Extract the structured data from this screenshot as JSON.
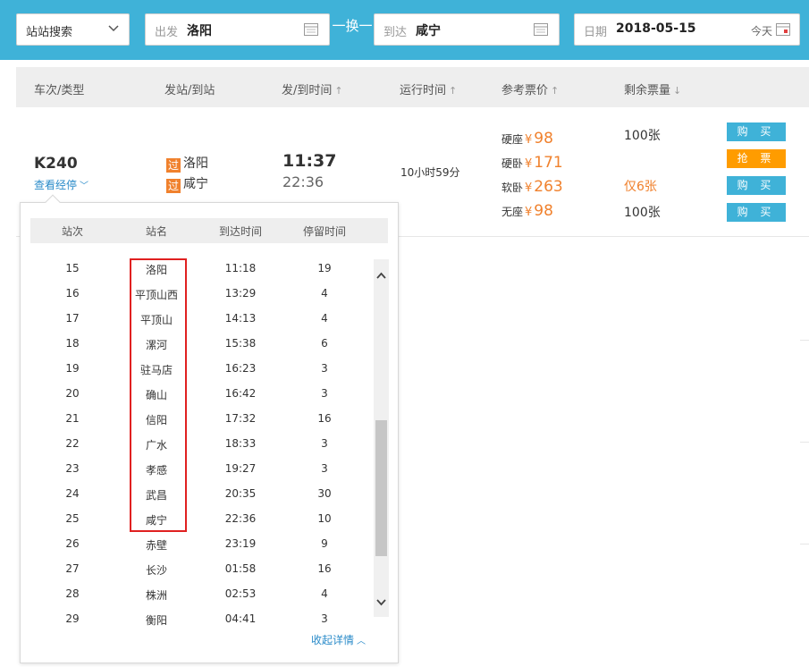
{
  "search": {
    "mode_label": "站站搜索",
    "from_label": "出发",
    "from_value": "洛阳",
    "swap_label": "一换一",
    "to_label": "到达",
    "to_value": "咸宁",
    "date_label": "日期",
    "date_value": "2018-05-15",
    "today_label": "今天"
  },
  "table_header": {
    "train_type": "车次/类型",
    "stations": "发站/到站",
    "times": "发/到时间",
    "duration": "运行时间",
    "price": "参考票价",
    "remaining": "剩余票量",
    "sort_up": "↑",
    "sort_down": "↓"
  },
  "train": {
    "number": "K240",
    "view_stops": "查看经停",
    "pass_tag": "过",
    "from_station": "洛阳",
    "to_station": "咸宁",
    "depart_time": "11:37",
    "arrive_time": "22:36",
    "duration": "10小时59分",
    "currency": "¥",
    "fares": [
      {
        "class": "硬座",
        "price": "98",
        "remaining": "100张",
        "button": "购 买",
        "warn": false,
        "grab": false
      },
      {
        "class": "硬卧",
        "price": "171",
        "remaining": "",
        "button": "抢 票",
        "warn": false,
        "grab": true
      },
      {
        "class": "软卧",
        "price": "263",
        "remaining": "仅6张",
        "button": "购 买",
        "warn": true,
        "grab": false
      },
      {
        "class": "无座",
        "price": "98",
        "remaining": "100张",
        "button": "购 买",
        "warn": false,
        "grab": false
      }
    ]
  },
  "stops_popup": {
    "headers": {
      "no": "站次",
      "name": "站名",
      "arrive": "到达时间",
      "stay": "停留时间"
    },
    "rows": [
      {
        "no": "15",
        "name": "洛阳",
        "arrive": "11:18",
        "stay": "19"
      },
      {
        "no": "16",
        "name": "平顶山西",
        "arrive": "13:29",
        "stay": "4"
      },
      {
        "no": "17",
        "name": "平顶山",
        "arrive": "14:13",
        "stay": "4"
      },
      {
        "no": "18",
        "name": "漯河",
        "arrive": "15:38",
        "stay": "6"
      },
      {
        "no": "19",
        "name": "驻马店",
        "arrive": "16:23",
        "stay": "3"
      },
      {
        "no": "20",
        "name": "确山",
        "arrive": "16:42",
        "stay": "3"
      },
      {
        "no": "21",
        "name": "信阳",
        "arrive": "17:32",
        "stay": "16"
      },
      {
        "no": "22",
        "name": "广水",
        "arrive": "18:33",
        "stay": "3"
      },
      {
        "no": "23",
        "name": "孝感",
        "arrive": "19:27",
        "stay": "3"
      },
      {
        "no": "24",
        "name": "武昌",
        "arrive": "20:35",
        "stay": "30"
      },
      {
        "no": "25",
        "name": "咸宁",
        "arrive": "22:36",
        "stay": "10"
      },
      {
        "no": "26",
        "name": "赤壁",
        "arrive": "23:19",
        "stay": "9"
      },
      {
        "no": "27",
        "name": "长沙",
        "arrive": "01:58",
        "stay": "16"
      },
      {
        "no": "28",
        "name": "株洲",
        "arrive": "02:53",
        "stay": "4"
      },
      {
        "no": "29",
        "name": "衡阳",
        "arrive": "04:41",
        "stay": "3"
      }
    ],
    "collapse_label": "收起详情"
  },
  "colors": {
    "brand": "#3fb2d8",
    "accent_orange": "#f0812d",
    "grab_button": "#ff9c00",
    "link": "#2a8bc9",
    "highlight_box": "#e02020"
  }
}
